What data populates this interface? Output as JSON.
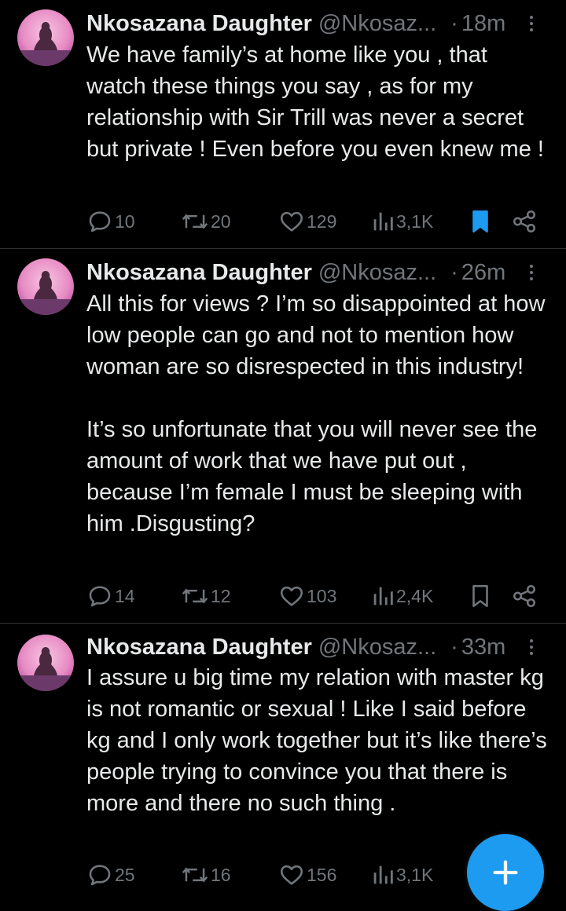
{
  "tweets": [
    {
      "name": "Nkosazana Daughter",
      "handle": "@Nkosaz...",
      "dot": "·",
      "time": "18m",
      "text": "We have family’s at home like you , that watch these things you say , as for my relationship with Sir Trill was never a secret but private ! Even before you even knew me !",
      "replies": "10",
      "reposts": "20",
      "likes": "129",
      "views": "3,1K",
      "bookmarked": true
    },
    {
      "name": "Nkosazana Daughter",
      "handle": "@Nkosaz...",
      "dot": "·",
      "time": "26m",
      "text": "All this for views ? I’m so disappointed at how low people can go and not to mention how woman are so disrespected in this industry!\n\nIt’s so unfortunate that you will never see the amount of work that we have put out , because I’m female I must be sleeping with him .Disgusting?",
      "replies": "14",
      "reposts": "12",
      "likes": "103",
      "views": "2,4K",
      "bookmarked": false
    },
    {
      "name": "Nkosazana Daughter",
      "handle": "@Nkosaz...",
      "dot": "·",
      "time": "33m",
      "text": "I assure u big time my relation with master kg is not romantic or sexual ! Like I said before kg and I only work together but it’s like there’s  people trying to convince you that there is more and there no such thing .",
      "replies": "25",
      "reposts": "16",
      "likes": "156",
      "views": "3,1K",
      "bookmarked": false
    }
  ],
  "icons": {
    "reply": "comment-bubble-icon",
    "repost": "repost-arrows-icon",
    "like": "heart-icon",
    "views": "bar-chart-icon",
    "bookmark": "bookmark-icon",
    "share": "share-icon",
    "more": "more-dots-icon",
    "compose": "plus-icon"
  },
  "colors": {
    "background": "#000000",
    "text": "#e7e9ea",
    "muted": "#71767b",
    "accent": "#1d9bf0",
    "divider": "#2f3336"
  }
}
